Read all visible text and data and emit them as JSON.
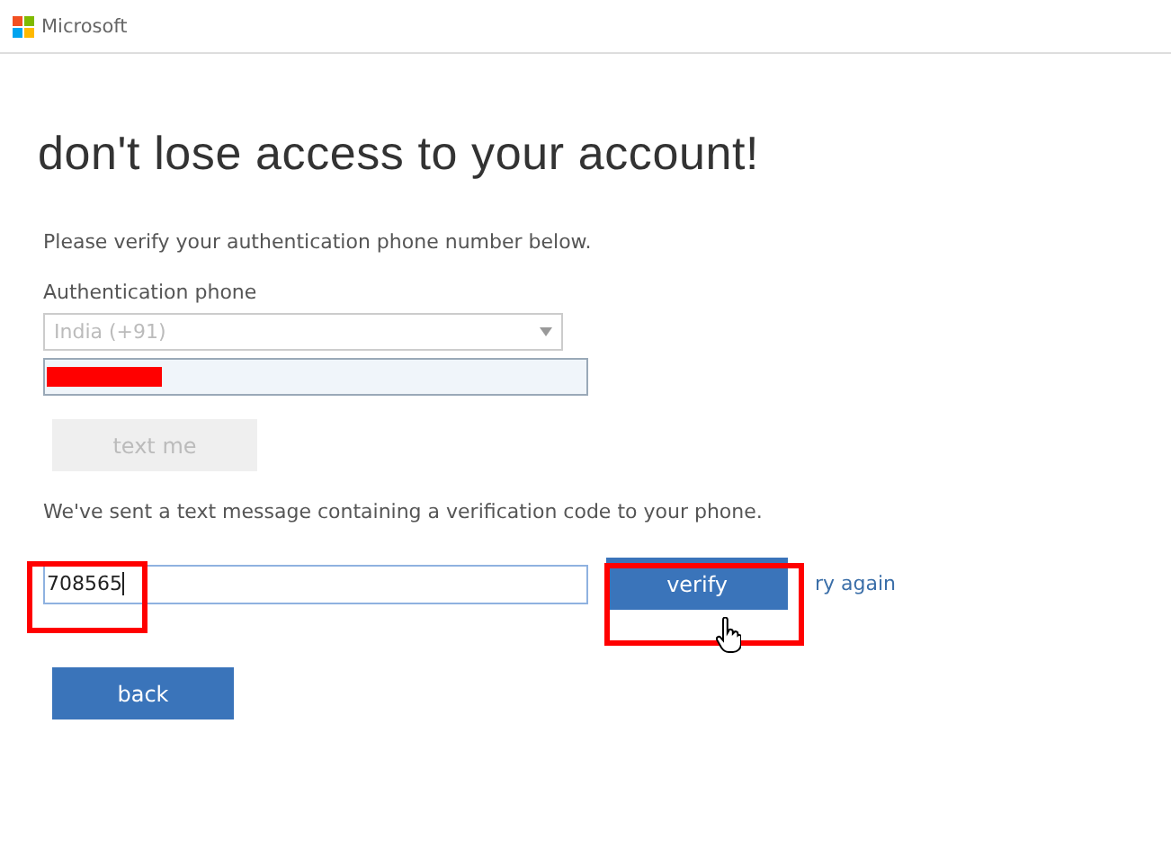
{
  "header": {
    "brand": "Microsoft"
  },
  "title": "don't lose access to your account!",
  "instruction": "Please verify your authentication phone number below.",
  "phone": {
    "label": "Authentication phone",
    "country": {
      "value": "India (+91)",
      "disabled": true
    }
  },
  "text_me_button": {
    "label": "text me",
    "disabled": true
  },
  "sent_message": "We've sent a text message containing a verification code to your phone.",
  "code_field": {
    "value": "708565"
  },
  "verify_button": {
    "label": "verify"
  },
  "try_again_link": "ry again",
  "back_button": {
    "label": "back"
  }
}
